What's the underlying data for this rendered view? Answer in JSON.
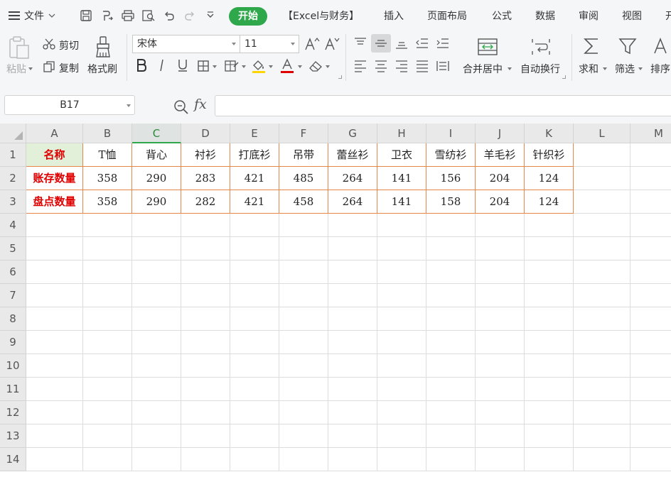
{
  "menubar": {
    "file_label": "文件",
    "home_tab": "开始",
    "tabs": [
      "【Excel与财务】",
      "插入",
      "页面布局",
      "公式",
      "数据",
      "审阅",
      "视图",
      "开"
    ]
  },
  "ribbon": {
    "paste_label": "粘贴",
    "cut_label": "剪切",
    "copy_label": "复制",
    "format_painter_label": "格式刷",
    "font_name": "宋体",
    "font_size": "11",
    "merge_center_label": "合并居中",
    "wrap_text_label": "自动换行",
    "sum_label": "求和",
    "filter_label": "筛选",
    "sort_label": "排序"
  },
  "formula_bar": {
    "name_box": "B17",
    "fx_label": "fx",
    "formula": ""
  },
  "sheet": {
    "columns": [
      "A",
      "B",
      "C",
      "D",
      "E",
      "F",
      "G",
      "H",
      "I",
      "J",
      "K",
      "L",
      "M"
    ],
    "active_column": "C",
    "row_numbers": [
      "1",
      "2",
      "3",
      "4",
      "5",
      "6",
      "7",
      "8",
      "9",
      "10",
      "11",
      "12",
      "13",
      "14"
    ],
    "rows": [
      [
        "名称",
        "T恤",
        "背心",
        "衬衫",
        "打底衫",
        "吊带",
        "蕾丝衫",
        "卫衣",
        "雪纺衫",
        "羊毛衫",
        "针织衫"
      ],
      [
        "账存数量",
        "358",
        "290",
        "283",
        "421",
        "485",
        "264",
        "141",
        "156",
        "204",
        "124"
      ],
      [
        "盘点数量",
        "358",
        "290",
        "282",
        "421",
        "458",
        "264",
        "141",
        "158",
        "204",
        "124"
      ]
    ]
  },
  "colors": {
    "accent_green": "#2ea84b",
    "header_fill": "#e2efd9",
    "label_red": "#e00000",
    "table_border": "#e6864a"
  }
}
